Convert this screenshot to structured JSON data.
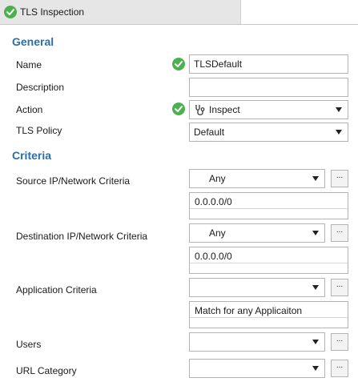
{
  "tab": {
    "title": "TLS Inspection",
    "icon": "check-circle-icon"
  },
  "sections": {
    "general": "General",
    "criteria": "Criteria"
  },
  "general": {
    "name": {
      "label": "Name",
      "value": "TLSDefault"
    },
    "description": {
      "label": "Description",
      "value": ""
    },
    "action": {
      "label": "Action",
      "value": "Inspect",
      "icon": "stethoscope-icon"
    },
    "tls_policy": {
      "label": "TLS Policy",
      "value": "Default"
    }
  },
  "criteria": {
    "source": {
      "label": "Source IP/Network Criteria",
      "select": "Any",
      "list_value": "0.0.0.0/0",
      "button": "..."
    },
    "destination": {
      "label": "Destination IP/Network Criteria",
      "select": "Any",
      "list_value": "0.0.0.0/0",
      "button": "..."
    },
    "application": {
      "label": "Application Criteria",
      "select": "",
      "list_value": "Match for any Applicaiton",
      "button": "..."
    },
    "users": {
      "label": "Users",
      "select": "",
      "button": "..."
    },
    "url_category": {
      "label": "URL Category",
      "select": "",
      "button": "..."
    }
  },
  "colors": {
    "accent": "#2f6ea3",
    "valid": "#4caf50"
  }
}
